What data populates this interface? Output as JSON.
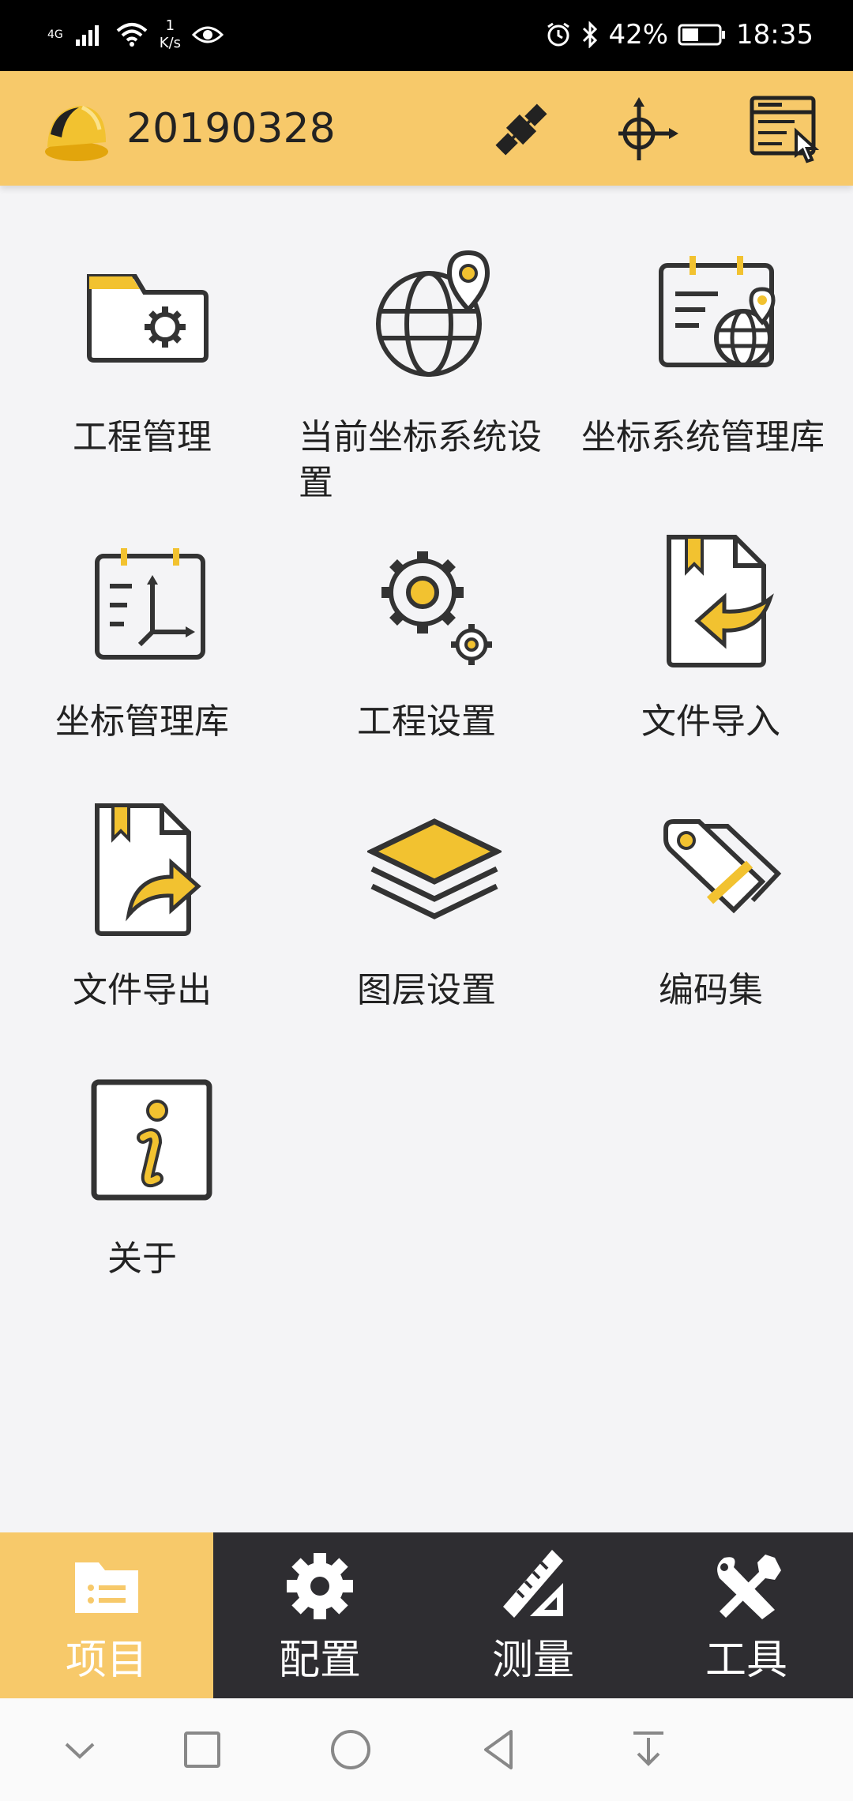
{
  "status_bar": {
    "network": "4G",
    "speed_value": "1",
    "speed_unit": "K/s",
    "battery": "42%",
    "time": "18:35"
  },
  "app_bar": {
    "title": "20190328"
  },
  "menu": {
    "items": [
      {
        "label": "工程管理",
        "icon": "project-folder-gear-icon"
      },
      {
        "label": "当前坐标系统设置",
        "icon": "globe-pin-icon"
      },
      {
        "label": "坐标系统管理库",
        "icon": "calendar-globe-icon"
      },
      {
        "label": "坐标管理库",
        "icon": "calendar-axes-icon"
      },
      {
        "label": "工程设置",
        "icon": "gears-icon"
      },
      {
        "label": "文件导入",
        "icon": "file-import-icon"
      },
      {
        "label": "文件导出",
        "icon": "file-export-icon"
      },
      {
        "label": "图层设置",
        "icon": "layers-icon"
      },
      {
        "label": "编码集",
        "icon": "tags-icon"
      },
      {
        "label": "关于",
        "icon": "info-icon"
      }
    ]
  },
  "bottom_nav": {
    "tabs": [
      {
        "label": "项目",
        "icon": "folder-list-icon",
        "active": true
      },
      {
        "label": "配置",
        "icon": "gear-icon",
        "active": false
      },
      {
        "label": "测量",
        "icon": "ruler-triangle-icon",
        "active": false
      },
      {
        "label": "工具",
        "icon": "wrench-screwdriver-icon",
        "active": false
      }
    ]
  },
  "colors": {
    "accent": "#f7c96a",
    "icon_yellow": "#f2c230",
    "icon_stroke": "#333333",
    "bottom_nav_bg": "#2e2d31"
  }
}
